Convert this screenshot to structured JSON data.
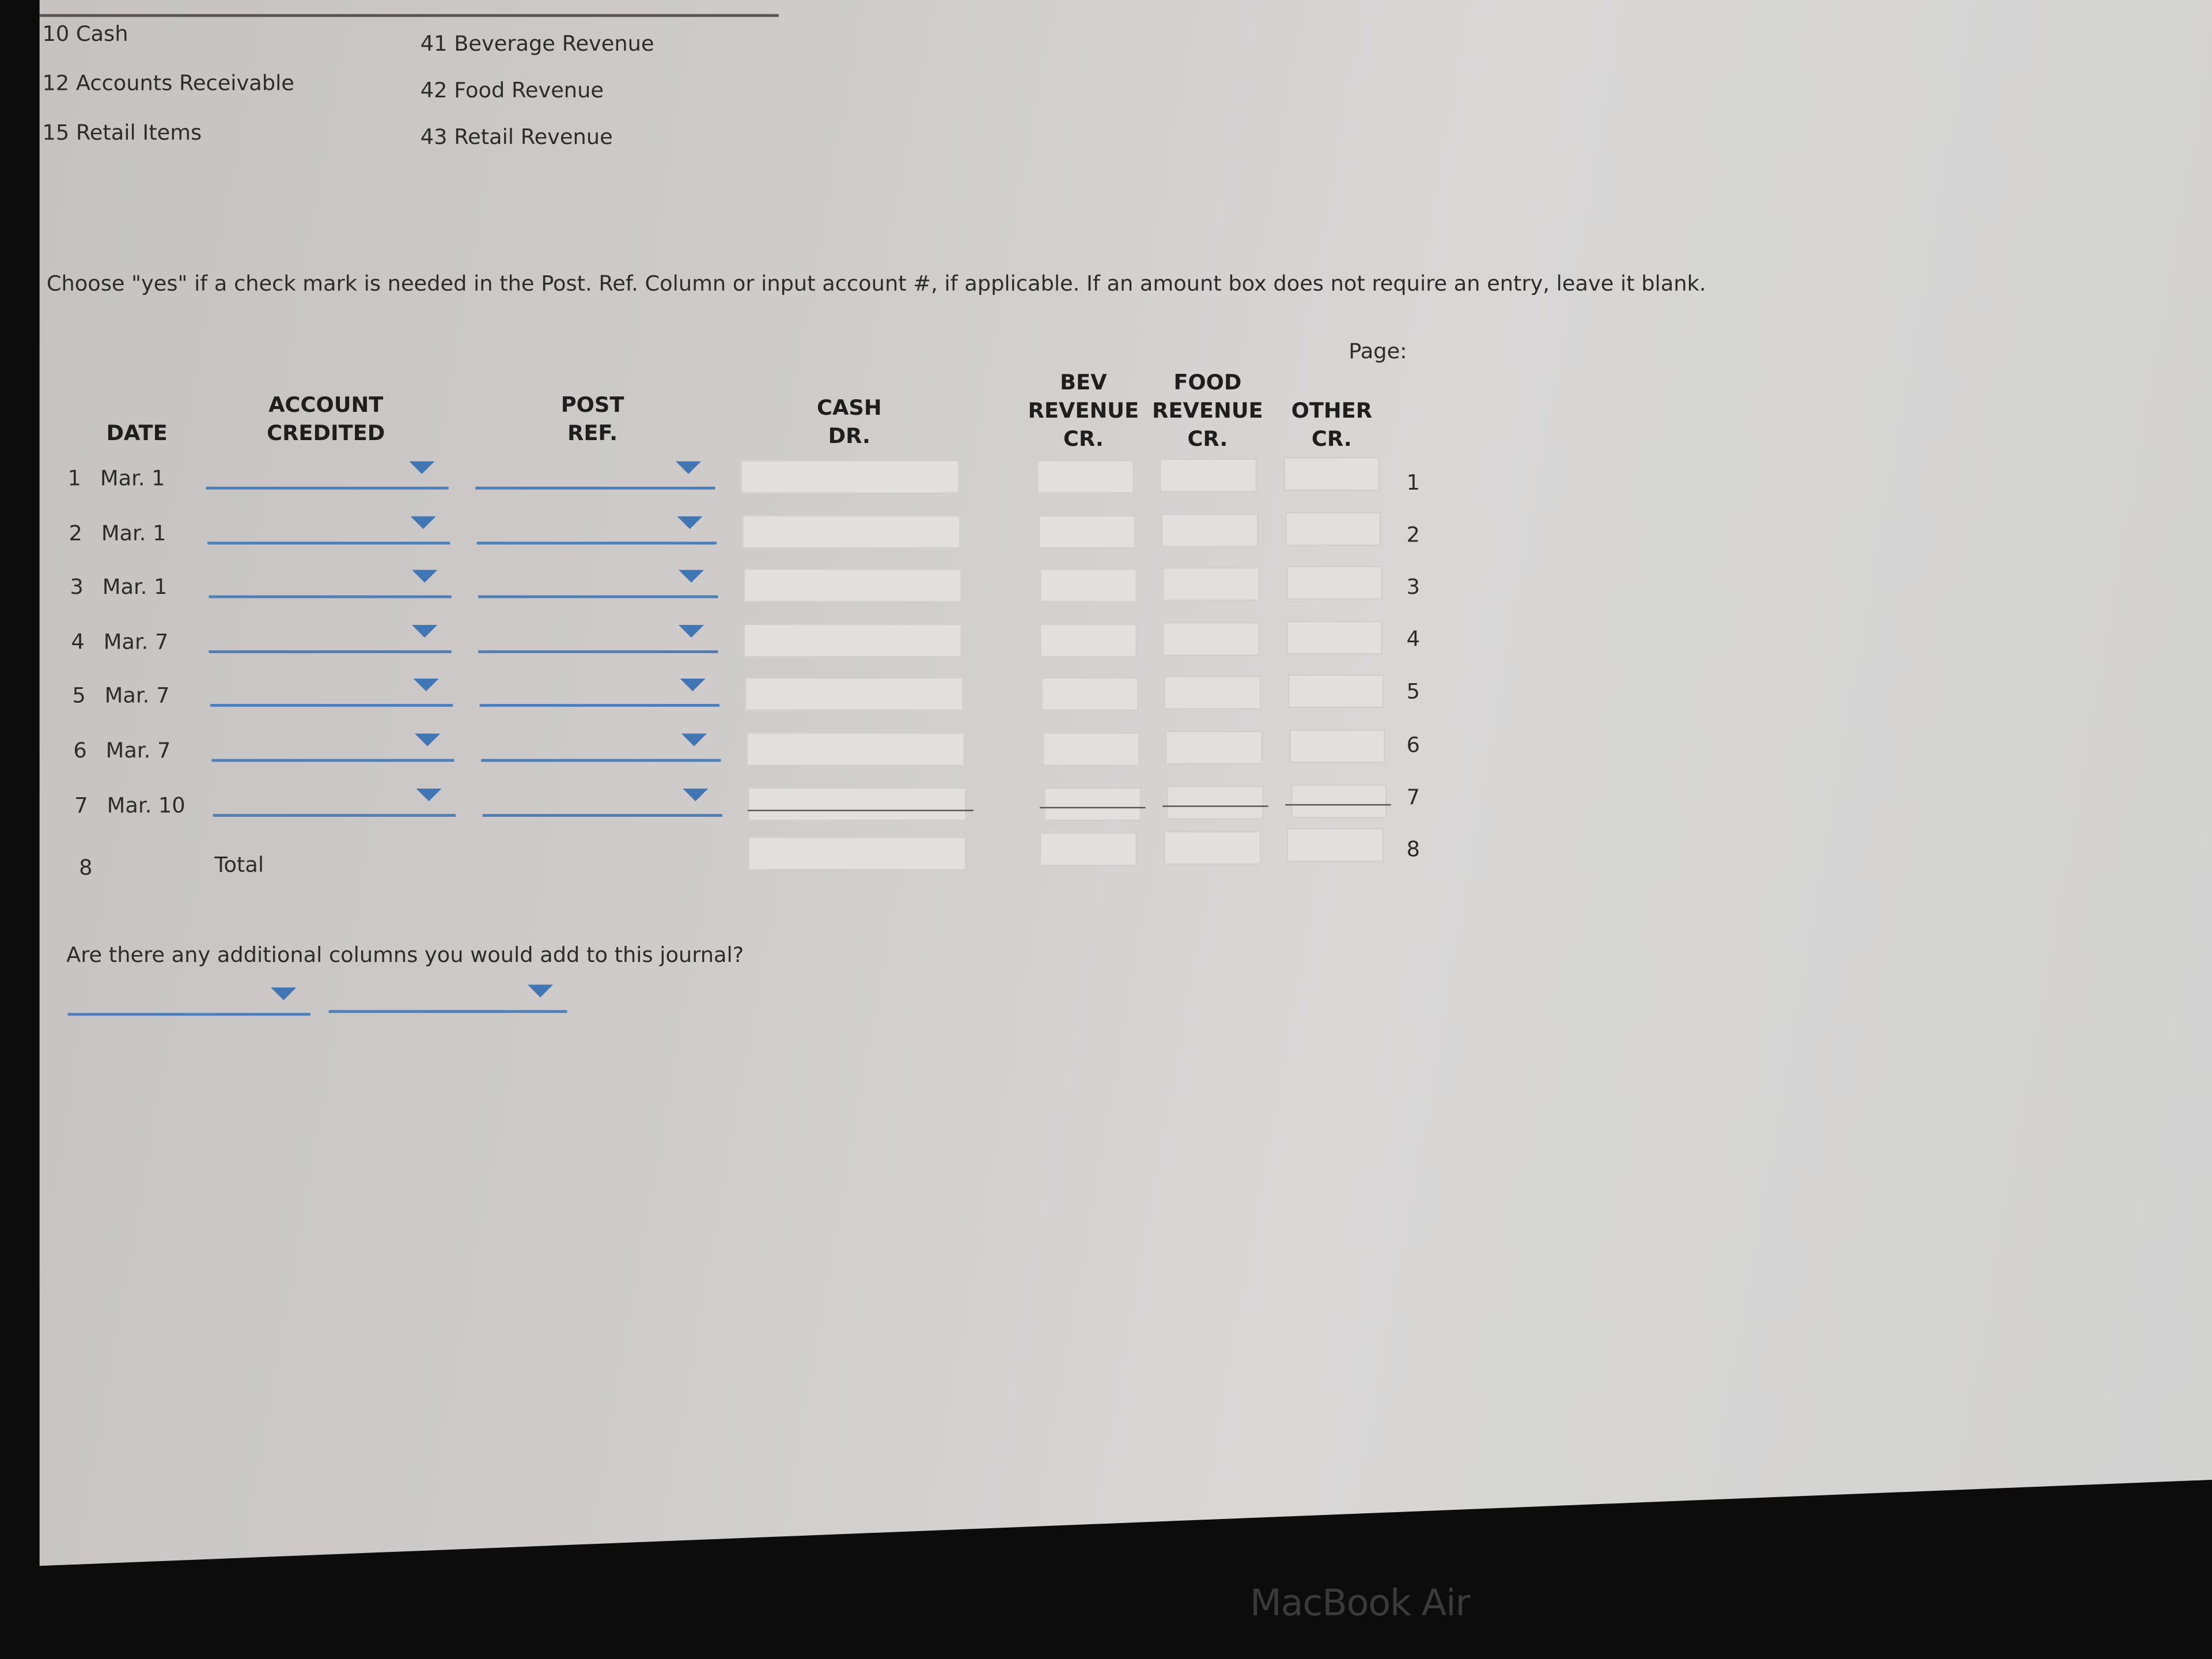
{
  "accounts_list": {
    "left": [
      "10 Cash",
      "12 Accounts Receivable",
      "15 Retail Items"
    ],
    "right": [
      "41 Beverage Revenue",
      "42 Food Revenue",
      "43 Retail Revenue"
    ]
  },
  "instructions": "Choose \"yes\" if a check mark is needed in the Post. Ref. Column or input account #, if applicable. If an amount box does not require an entry, leave it blank.",
  "page_label": "Page:",
  "headers": {
    "date": "DATE",
    "account_credited": "ACCOUNT\nCREDITED",
    "post_ref": "POST\nREF.",
    "cash_dr": "CASH\nDR.",
    "bev_revenue_cr": "BEV\nREVENUE\nCR.",
    "food_revenue_cr": "FOOD\nREVENUE\nCR.",
    "other_cr": "OTHER\nCR."
  },
  "rows": [
    {
      "num": "1",
      "date": "Mar. 1"
    },
    {
      "num": "2",
      "date": "Mar. 1"
    },
    {
      "num": "3",
      "date": "Mar. 1"
    },
    {
      "num": "4",
      "date": "Mar. 7"
    },
    {
      "num": "5",
      "date": "Mar. 7"
    },
    {
      "num": "6",
      "date": "Mar. 7"
    },
    {
      "num": "7",
      "date": "Mar. 10"
    }
  ],
  "total_row": {
    "num": "8",
    "label": "Total"
  },
  "question": "Are there any additional columns you would add to this journal?",
  "bezel_label": "MacBook Air",
  "colors": {
    "dropdown_accent": "#3f76b3",
    "input_fill": "#e1e0de"
  }
}
